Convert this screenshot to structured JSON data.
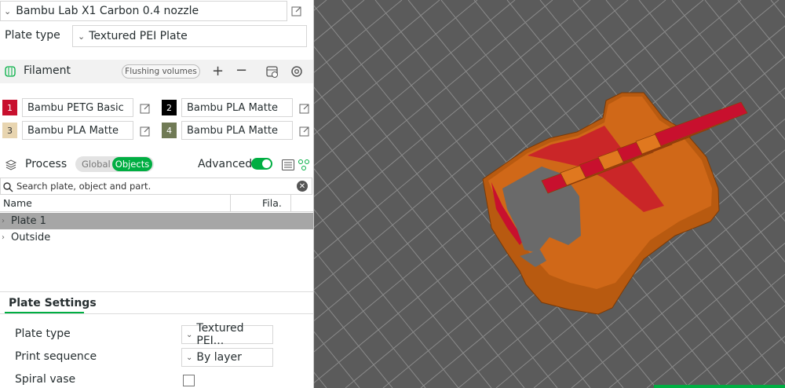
{
  "printer": {
    "name": "Bambu Lab X1 Carbon 0.4 nozzle"
  },
  "plate": {
    "label": "Plate type",
    "value": "Textured PEI Plate"
  },
  "filament": {
    "title": "Filament",
    "flushing_label": "Flushing volumes",
    "items": [
      {
        "num": "1",
        "name": "Bambu PETG Basic",
        "color": "#c8102e",
        "text_color": "#ffffff"
      },
      {
        "num": "2",
        "name": "Bambu PLA Matte",
        "color": "#000000",
        "text_color": "#ffffff"
      },
      {
        "num": "3",
        "name": "Bambu PLA Matte",
        "color": "#e8d5b0",
        "text_color": "#333333"
      },
      {
        "num": "4",
        "name": "Bambu PLA Matte",
        "color": "#707a55",
        "text_color": "#ffffff"
      }
    ]
  },
  "process": {
    "title": "Process",
    "global_label": "Global",
    "objects_label": "Objects",
    "advanced_label": "Advanced",
    "advanced_on": true
  },
  "search": {
    "placeholder": "Search plate, object and part."
  },
  "tree": {
    "col_name": "Name",
    "col_fila": "Fila.",
    "rows": [
      {
        "label": "Plate 1",
        "selected": true
      },
      {
        "label": "Outside",
        "selected": false
      }
    ]
  },
  "plate_settings": {
    "title": "Plate Settings",
    "options": [
      {
        "label": "Plate type",
        "value": "Textured PEI..."
      },
      {
        "label": "Print sequence",
        "value": "By layer"
      },
      {
        "label": "Spiral vase",
        "checked": false
      }
    ]
  },
  "colors": {
    "accent": "#00ae42",
    "bed": "#5b5b5b",
    "model": "#c45f12",
    "model_infill": "#c8102e"
  }
}
